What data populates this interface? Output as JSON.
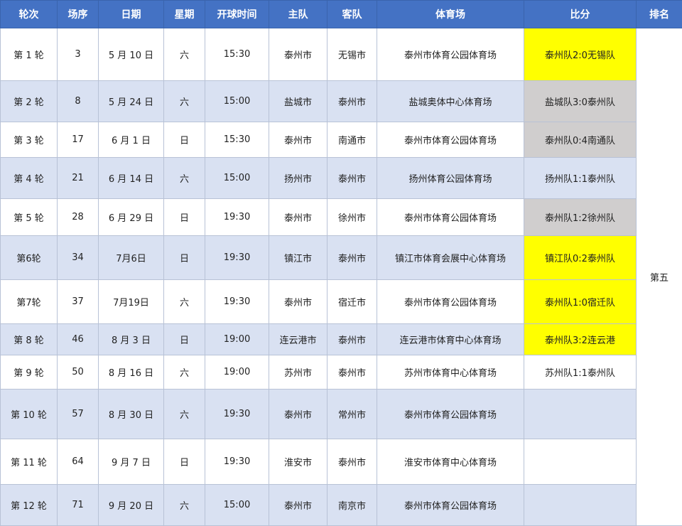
{
  "headers": [
    "轮次",
    "场序",
    "日期",
    "星期",
    "开球时间",
    "主队",
    "客队",
    "体育场",
    "比分",
    "排名"
  ],
  "rank": "第五",
  "colors": {
    "header_bg": "#4472c4",
    "row_alt": "#d9e1f2",
    "win_highlight": "#ffff00",
    "loss_highlight": "#d0cece"
  },
  "rows": [
    {
      "round": "第 1 轮",
      "seq": "3",
      "date": "5 月 10 日",
      "weekday": "六",
      "time": "15:30",
      "home": "泰州市",
      "away": "无锡市",
      "stadium": "泰州市体育公园体育场",
      "score": "泰州队2:0无锡队",
      "highlight": "yellow"
    },
    {
      "round": "第 2 轮",
      "seq": "8",
      "date": "5 月 24 日",
      "weekday": "六",
      "time": "15:00",
      "home": "盐城市",
      "away": "泰州市",
      "stadium": "盐城奥体中心体育场",
      "score": "盐城队3:0泰州队",
      "highlight": "gray"
    },
    {
      "round": "第 3 轮",
      "seq": "17",
      "date": "6 月 1 日",
      "weekday": "日",
      "time": "15:30",
      "home": "泰州市",
      "away": "南通市",
      "stadium": "泰州市体育公园体育场",
      "score": "泰州队0:4南通队",
      "highlight": "gray"
    },
    {
      "round": "第 4 轮",
      "seq": "21",
      "date": "6 月 14 日",
      "weekday": "六",
      "time": "15:00",
      "home": "扬州市",
      "away": "泰州市",
      "stadium": "扬州体育公园体育场",
      "score": "扬州队1:1泰州队",
      "highlight": "none"
    },
    {
      "round": "第 5 轮",
      "seq": "28",
      "date": "6 月 29 日",
      "weekday": "日",
      "time": "19:30",
      "home": "泰州市",
      "away": "徐州市",
      "stadium": "泰州市体育公园体育场",
      "score": "泰州队1:2徐州队",
      "highlight": "gray"
    },
    {
      "round": "第6轮",
      "seq": "34",
      "date": "7月6日",
      "weekday": "日",
      "time": "19:30",
      "home": "镇江市",
      "away": "泰州市",
      "stadium": "镇江市体育会展中心体育场",
      "score": "镇江队0:2泰州队",
      "highlight": "yellow"
    },
    {
      "round": "第7轮",
      "seq": "37",
      "date": "7月19日",
      "weekday": "六",
      "time": "19:30",
      "home": "泰州市",
      "away": "宿迁市",
      "stadium": "泰州市体育公园体育场",
      "score": "泰州队1:0宿迁队",
      "highlight": "yellow"
    },
    {
      "round": "第 8 轮",
      "seq": "46",
      "date": "8 月 3 日",
      "weekday": "日",
      "time": "19:00",
      "home": "连云港市",
      "away": "泰州市",
      "stadium": "连云港市体育中心体育场",
      "score": "泰州队3:2连云港",
      "highlight": "yellow"
    },
    {
      "round": "第 9 轮",
      "seq": "50",
      "date": "8 月 16 日",
      "weekday": "六",
      "time": "19:00",
      "home": "苏州市",
      "away": "泰州市",
      "stadium": "苏州市体育中心体育场",
      "score": "苏州队1:1泰州队",
      "highlight": "none"
    },
    {
      "round": "第 10 轮",
      "seq": "57",
      "date": "8 月 30 日",
      "weekday": "六",
      "time": "19:30",
      "home": "泰州市",
      "away": "常州市",
      "stadium": "泰州市体育公园体育场",
      "score": "",
      "highlight": "none"
    },
    {
      "round": "第 11 轮",
      "seq": "64",
      "date": "9 月 7 日",
      "weekday": "日",
      "time": "19:30",
      "home": "淮安市",
      "away": "泰州市",
      "stadium": "淮安市体育中心体育场",
      "score": "",
      "highlight": "none"
    },
    {
      "round": "第 12 轮",
      "seq": "71",
      "date": "9 月 20 日",
      "weekday": "六",
      "time": "15:00",
      "home": "泰州市",
      "away": "南京市",
      "stadium": "泰州市体育公园体育场",
      "score": "",
      "highlight": "none"
    }
  ]
}
